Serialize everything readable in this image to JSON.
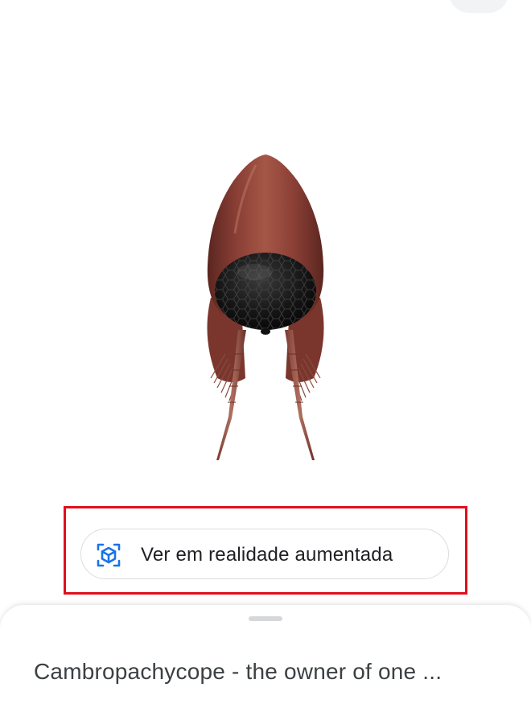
{
  "model_viewer": {
    "subject": "Cambropachycope 3D model",
    "colors": {
      "body": "#8a3f35",
      "body_highlight": "#b86a5c",
      "body_shadow": "#5a2620",
      "eye": "#141414",
      "eye_highlight": "#3a3a3a"
    }
  },
  "corner_button": {
    "color": "#f1f3f4"
  },
  "ar_button": {
    "label": "Ver em realidade aumentada",
    "icon": "ar-cube-icon",
    "icon_color": "#1a73e8"
  },
  "highlight": {
    "color": "#e0101e"
  },
  "bottom_sheet": {
    "title": "Cambropachycope - the owner of one ..."
  }
}
